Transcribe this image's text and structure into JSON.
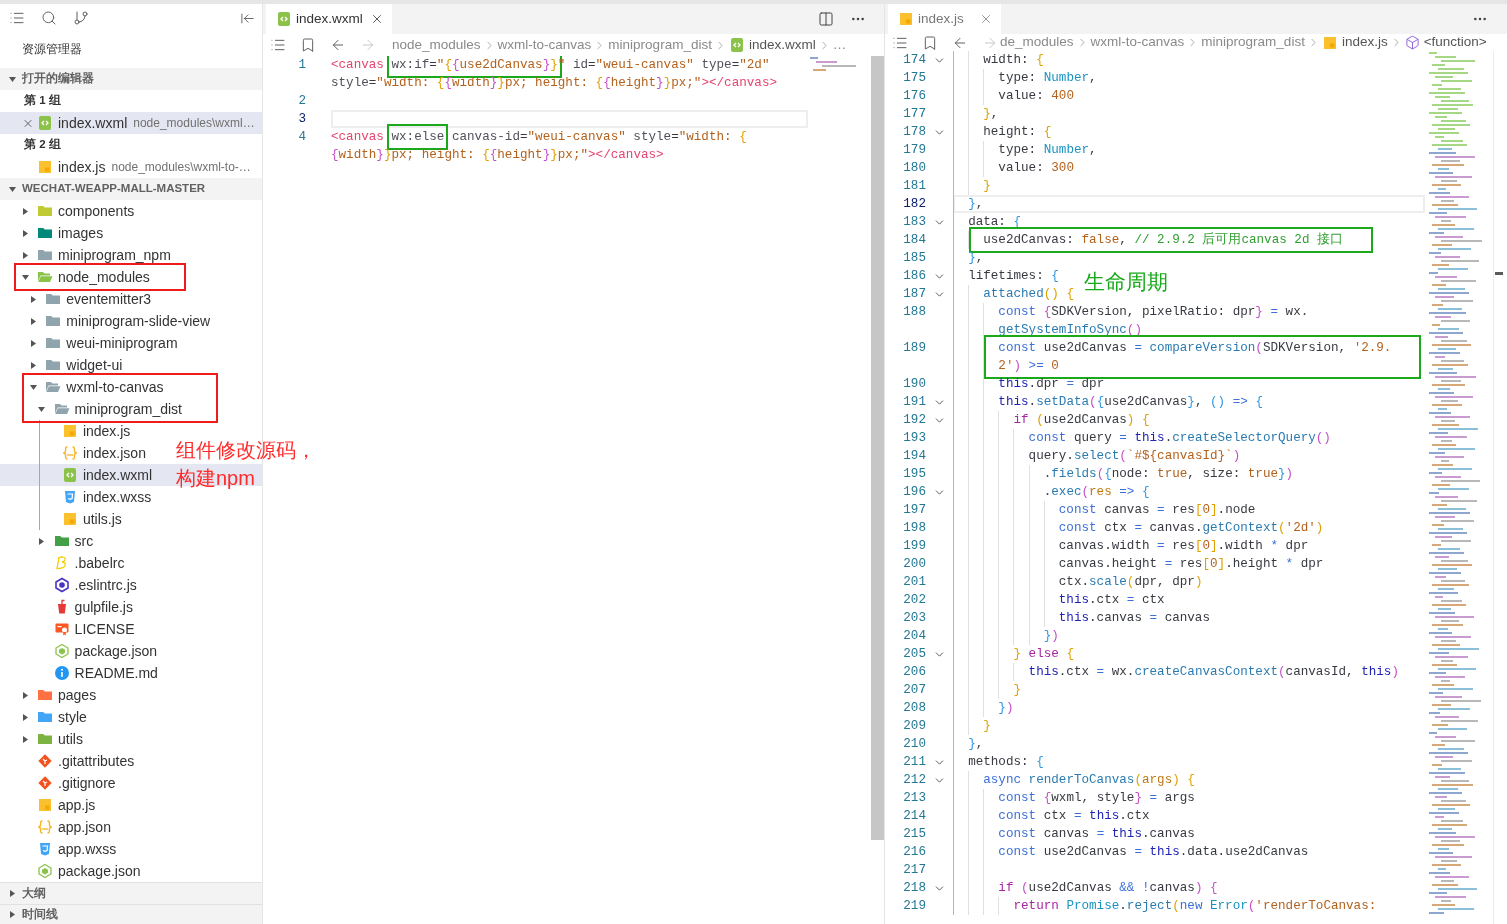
{
  "explorer": {
    "title": "资源管理器",
    "open_editors": {
      "label": "打开的编辑器",
      "expanded": true,
      "groups": [
        {
          "label": "第 1 组",
          "items": [
            {
              "name": "index.wxml",
              "description": "node_modules\\wxml…",
              "kind": "wxml",
              "selected": true
            }
          ]
        },
        {
          "label": "第 2 组",
          "items": [
            {
              "name": "index.js",
              "description": "node_modules\\wxml-to-…",
              "kind": "js",
              "selected": false
            }
          ]
        }
      ]
    },
    "project": {
      "label": "WECHAT-WEAPP-MALL-MASTER",
      "expanded": true,
      "tree": [
        {
          "name": "components",
          "kind": "folder",
          "color": "#c0ca33",
          "expanded": false,
          "selected": false,
          "framed": false
        },
        {
          "name": "images",
          "kind": "folder",
          "color": "#00897b",
          "expanded": false,
          "selected": false,
          "framed": false
        },
        {
          "name": "miniprogram_npm",
          "kind": "folder",
          "color": "#90a4ae",
          "expanded": false,
          "selected": false,
          "framed": false
        },
        {
          "name": "node_modules",
          "kind": "folder",
          "color": "#8bc34a",
          "expanded": true,
          "selected": false,
          "framed": true,
          "children": [
            {
              "name": "eventemitter3",
              "kind": "folder",
              "color": "#90a4ae",
              "expanded": false,
              "selected": false,
              "framed": false
            },
            {
              "name": "miniprogram-slide-view",
              "kind": "folder",
              "color": "#90a4ae",
              "expanded": false,
              "selected": false,
              "framed": false
            },
            {
              "name": "weui-miniprogram",
              "kind": "folder",
              "color": "#90a4ae",
              "expanded": false,
              "selected": false,
              "framed": false
            },
            {
              "name": "widget-ui",
              "kind": "folder",
              "color": "#90a4ae",
              "expanded": false,
              "selected": false,
              "framed": false
            },
            {
              "name": "wxml-to-canvas",
              "kind": "folder",
              "color": "#90a4ae",
              "expanded": true,
              "selected": false,
              "framed": true,
              "children": [
                {
                  "name": "miniprogram_dist",
                  "kind": "folder",
                  "color": "#90a4ae",
                  "expanded": true,
                  "selected": false,
                  "framed": true,
                  "children": [
                    {
                      "name": "index.js",
                      "kind": "js",
                      "selected": false,
                      "framed": false
                    },
                    {
                      "name": "index.json",
                      "kind": "json",
                      "selected": false,
                      "framed": false
                    },
                    {
                      "name": "index.wxml",
                      "kind": "wxml",
                      "selected": true,
                      "framed": false
                    },
                    {
                      "name": "index.wxss",
                      "kind": "wxss",
                      "selected": false,
                      "framed": false
                    },
                    {
                      "name": "utils.js",
                      "kind": "js",
                      "selected": false,
                      "framed": false
                    }
                  ]
                },
                {
                  "name": "src",
                  "kind": "folder",
                  "color": "#43a047",
                  "expanded": false,
                  "selected": false,
                  "framed": false
                },
                {
                  "name": ".babelrc",
                  "kind": "babel",
                  "selected": false,
                  "framed": false
                },
                {
                  "name": ".eslintrc.js",
                  "kind": "eslint",
                  "selected": false,
                  "framed": false
                },
                {
                  "name": "gulpfile.js",
                  "kind": "gulp",
                  "selected": false,
                  "framed": false
                },
                {
                  "name": "LICENSE",
                  "kind": "license",
                  "selected": false,
                  "framed": false
                },
                {
                  "name": "package.json",
                  "kind": "npm",
                  "selected": false,
                  "framed": false
                },
                {
                  "name": "README.md",
                  "kind": "info",
                  "selected": false,
                  "framed": false
                }
              ]
            }
          ]
        },
        {
          "name": "pages",
          "kind": "folder",
          "color": "#ff7043",
          "expanded": false,
          "selected": false,
          "framed": false
        },
        {
          "name": "style",
          "kind": "folder",
          "color": "#42a5f5",
          "expanded": false,
          "selected": false,
          "framed": false
        },
        {
          "name": "utils",
          "kind": "folder",
          "color": "#7cb342",
          "expanded": false,
          "selected": false,
          "framed": false
        },
        {
          "name": ".gitattributes",
          "kind": "git",
          "selected": false,
          "framed": false
        },
        {
          "name": ".gitignore",
          "kind": "git",
          "selected": false,
          "framed": false
        },
        {
          "name": "app.js",
          "kind": "js",
          "selected": false,
          "framed": false
        },
        {
          "name": "app.json",
          "kind": "json",
          "selected": false,
          "framed": false
        },
        {
          "name": "app.wxss",
          "kind": "wxss",
          "selected": false,
          "framed": false
        },
        {
          "name": "package.json",
          "kind": "npm",
          "selected": false,
          "framed": false
        }
      ]
    },
    "note": [
      "组件修改源码，",
      "构建npm"
    ],
    "sections": [
      {
        "label": "大纲",
        "expanded": false
      },
      {
        "label": "时间线",
        "expanded": false
      }
    ]
  },
  "editors": [
    {
      "focused": true,
      "tabs": [
        {
          "label": "index.wxml",
          "kind": "wxml",
          "selected": true
        }
      ],
      "nav": [
        {
          "kind": "back",
          "disabled": false
        },
        {
          "kind": "forward",
          "disabled": true
        }
      ],
      "breadcrumb": [
        {
          "label": "node_modules"
        },
        {
          "label": "wxml-to-canvas"
        },
        {
          "label": "miniprogram_dist"
        },
        {
          "label": "index.wxml",
          "kind": "wxml"
        },
        {
          "label": "…"
        }
      ],
      "lines": [
        {
          "n": "1",
          "current": false,
          "tokens": [
            {
              "kind": "tag",
              "text": "<canvas "
            },
            {
              "kind": "frame",
              "tokens": [
                {
                  "kind": "attr",
                  "text": "wx:if"
                },
                {
                  "kind": "p",
                  "text": "="
                },
                {
                  "kind": "str",
                  "text": "\""
                },
                {
                  "kind": "b1",
                  "text": "{"
                },
                {
                  "kind": "b2",
                  "text": "{"
                },
                {
                  "kind": "str",
                  "text": "use2dCanvas"
                },
                {
                  "kind": "b2",
                  "text": "}"
                },
                {
                  "kind": "b1",
                  "text": "}"
                }
              ]
            },
            {
              "kind": "str",
              "text": "\" "
            },
            {
              "kind": "attr",
              "text": "id"
            },
            {
              "kind": "p",
              "text": "="
            },
            {
              "kind": "str",
              "text": "\"weui-canvas\" "
            },
            {
              "kind": "attr",
              "text": "type"
            },
            {
              "kind": "p",
              "text": "="
            },
            {
              "kind": "str",
              "text": "\"2d\""
            }
          ],
          "continuation": [
            {
              "kind": "attr",
              "text": "style"
            },
            {
              "kind": "p",
              "text": "="
            },
            {
              "kind": "str",
              "text": "\"width: "
            },
            {
              "kind": "b1",
              "text": "{"
            },
            {
              "kind": "b2",
              "text": "{"
            },
            {
              "kind": "str",
              "text": "width"
            },
            {
              "kind": "b2",
              "text": "}"
            },
            {
              "kind": "b1",
              "text": "}"
            },
            {
              "kind": "str",
              "text": "px; height: "
            },
            {
              "kind": "b1",
              "text": "{"
            },
            {
              "kind": "b2",
              "text": "{"
            },
            {
              "kind": "str",
              "text": "height"
            },
            {
              "kind": "b2",
              "text": "}"
            },
            {
              "kind": "b1",
              "text": "}"
            },
            {
              "kind": "str",
              "text": "px;\""
            },
            {
              "kind": "tag",
              "text": "></canvas>"
            }
          ]
        },
        {
          "n": "2",
          "current": false
        },
        {
          "n": "3",
          "current": true
        },
        {
          "n": "4",
          "current": false,
          "tokens": [
            {
              "kind": "tag",
              "text": "<canvas "
            },
            {
              "kind": "frame",
              "tokens": [
                {
                  "kind": "attr",
                  "text": "wx:else"
                }
              ]
            },
            {
              "kind": "attr",
              "text": " canvas-id"
            },
            {
              "kind": "p",
              "text": "="
            },
            {
              "kind": "str",
              "text": "\"weui-canvas\" "
            },
            {
              "kind": "attr",
              "text": "style"
            },
            {
              "kind": "p",
              "text": "="
            },
            {
              "kind": "str",
              "text": "\"width: "
            },
            {
              "kind": "b1",
              "text": "{"
            }
          ],
          "continuation": [
            {
              "kind": "b2",
              "text": "{"
            },
            {
              "kind": "str",
              "text": "width"
            },
            {
              "kind": "b2",
              "text": "}"
            },
            {
              "kind": "b1",
              "text": "}"
            },
            {
              "kind": "str",
              "text": "px; height: "
            },
            {
              "kind": "b1",
              "text": "{"
            },
            {
              "kind": "b2",
              "text": "{"
            },
            {
              "kind": "str",
              "text": "height"
            },
            {
              "kind": "b2",
              "text": "}"
            },
            {
              "kind": "b1",
              "text": "}"
            },
            {
              "kind": "str",
              "text": "px;\""
            },
            {
              "kind": "tag",
              "text": "></canvas>"
            }
          ]
        }
      ]
    },
    {
      "focused": false,
      "tabs": [
        {
          "label": "index.js",
          "kind": "js",
          "selected": true
        }
      ],
      "nav": [
        {
          "kind": "back",
          "disabled": false
        },
        {
          "kind": "forward",
          "disabled": true
        }
      ],
      "breadcrumb": [
        {
          "label": "de_modules"
        },
        {
          "label": "wxml-to-canvas"
        },
        {
          "label": "miniprogram_dist"
        },
        {
          "label": "index.js",
          "kind": "js"
        },
        {
          "label": "<function>",
          "kind": "symbol"
        }
      ],
      "note": "生命周期",
      "lines": [
        {
          "n": "174",
          "fold": true,
          "current": false,
          "framed": false,
          "tokens": [
            {
              "kind": "p",
              "text": "    width: "
            },
            {
              "kind": "b1",
              "text": "{"
            }
          ]
        },
        {
          "n": "175",
          "fold": false,
          "current": false,
          "framed": false,
          "tokens": [
            {
              "kind": "p",
              "text": "      type: "
            },
            {
              "kind": "type",
              "text": "Number"
            },
            {
              "kind": "p",
              "text": ","
            }
          ]
        },
        {
          "n": "176",
          "fold": false,
          "current": false,
          "framed": false,
          "tokens": [
            {
              "kind": "p",
              "text": "      value: "
            },
            {
              "kind": "num",
              "text": "400"
            }
          ]
        },
        {
          "n": "177",
          "fold": false,
          "current": false,
          "framed": false,
          "tokens": [
            {
              "kind": "b1",
              "text": "    }"
            },
            {
              "kind": "p",
              "text": ","
            }
          ]
        },
        {
          "n": "178",
          "fold": true,
          "current": false,
          "framed": false,
          "tokens": [
            {
              "kind": "p",
              "text": "    height: "
            },
            {
              "kind": "b1",
              "text": "{"
            }
          ]
        },
        {
          "n": "179",
          "fold": false,
          "current": false,
          "framed": false,
          "tokens": [
            {
              "kind": "p",
              "text": "      type: "
            },
            {
              "kind": "type",
              "text": "Number"
            },
            {
              "kind": "p",
              "text": ","
            }
          ]
        },
        {
          "n": "180",
          "fold": false,
          "current": false,
          "framed": false,
          "tokens": [
            {
              "kind": "p",
              "text": "      value: "
            },
            {
              "kind": "num",
              "text": "300"
            }
          ]
        },
        {
          "n": "181",
          "fold": false,
          "current": false,
          "framed": false,
          "tokens": [
            {
              "kind": "b1",
              "text": "    }"
            }
          ]
        },
        {
          "n": "182",
          "fold": false,
          "current": true,
          "framed": false,
          "tokens": [
            {
              "kind": "b3",
              "text": "  }"
            },
            {
              "kind": "p",
              "text": ","
            }
          ]
        },
        {
          "n": "183",
          "fold": true,
          "current": false,
          "framed": false,
          "tokens": [
            {
              "kind": "p",
              "text": "  data: "
            },
            {
              "kind": "b3",
              "text": "{"
            }
          ]
        },
        {
          "n": "184",
          "fold": false,
          "current": false,
          "framed": true,
          "tokens": [
            {
              "kind": "p",
              "text": "    use2dCanvas: "
            },
            {
              "kind": "num",
              "text": "false"
            },
            {
              "kind": "p",
              "text": ", "
            },
            {
              "kind": "cmt",
              "text": "// 2.9.2 后可用canvas 2d 接口"
            }
          ]
        },
        {
          "n": "185",
          "fold": false,
          "current": false,
          "framed": false,
          "tokens": [
            {
              "kind": "b3",
              "text": "  }"
            },
            {
              "kind": "p",
              "text": ","
            }
          ]
        },
        {
          "n": "186",
          "fold": true,
          "current": false,
          "framed": false,
          "tokens": [
            {
              "kind": "p",
              "text": "  lifetimes: "
            },
            {
              "kind": "b3",
              "text": "{"
            }
          ]
        },
        {
          "n": "187",
          "fold": true,
          "current": false,
          "framed": false,
          "tokens": [
            {
              "kind": "fn",
              "text": "    attached"
            },
            {
              "kind": "b1",
              "text": "() {"
            }
          ]
        },
        {
          "n": "188",
          "fold": false,
          "current": false,
          "framed": false,
          "tokens": [
            {
              "kind": "kw",
              "text": "      const "
            },
            {
              "kind": "b2",
              "text": "{"
            },
            {
              "kind": "p",
              "text": "SDKVersion, pixelRatio: dpr"
            },
            {
              "kind": "b2",
              "text": "} "
            },
            {
              "kind": "op",
              "text": "= "
            },
            {
              "kind": "p",
              "text": "wx."
            }
          ],
          "continuation": [
            {
              "kind": "fn",
              "text": "getSystemInfoSync"
            },
            {
              "kind": "b2",
              "text": "()"
            }
          ]
        },
        {
          "n": "189",
          "fold": false,
          "current": false,
          "framed": true,
          "tokens": [
            {
              "kind": "kw",
              "text": "      const "
            },
            {
              "kind": "p",
              "text": "use2dCanvas "
            },
            {
              "kind": "op",
              "text": "= "
            },
            {
              "kind": "fn",
              "text": "compareVersion"
            },
            {
              "kind": "b2",
              "text": "("
            },
            {
              "kind": "p",
              "text": "SDKVersion, "
            },
            {
              "kind": "str",
              "text": "'2.9."
            }
          ],
          "continuation": [
            {
              "kind": "str",
              "text": "2'"
            },
            {
              "kind": "b2",
              "text": ") "
            },
            {
              "kind": "op",
              "text": ">= "
            },
            {
              "kind": "num",
              "text": "0"
            }
          ]
        },
        {
          "n": "190",
          "fold": false,
          "current": false,
          "framed": false,
          "tokens": [
            {
              "kind": "this",
              "text": "      this"
            },
            {
              "kind": "p",
              "text": ".dpr "
            },
            {
              "kind": "op",
              "text": "= "
            },
            {
              "kind": "p",
              "text": "dpr"
            }
          ]
        },
        {
          "n": "191",
          "fold": true,
          "current": false,
          "framed": false,
          "tokens": [
            {
              "kind": "this",
              "text": "      this"
            },
            {
              "kind": "p",
              "text": "."
            },
            {
              "kind": "fn",
              "text": "setData"
            },
            {
              "kind": "b2",
              "text": "("
            },
            {
              "kind": "b3",
              "text": "{"
            },
            {
              "kind": "p",
              "text": "use2dCanvas"
            },
            {
              "kind": "b3",
              "text": "}"
            },
            {
              "kind": "p",
              "text": ", "
            },
            {
              "kind": "b3",
              "text": "() "
            },
            {
              "kind": "op",
              "text": "=> "
            },
            {
              "kind": "b3",
              "text": "{"
            }
          ]
        },
        {
          "n": "192",
          "fold": true,
          "current": false,
          "framed": false,
          "tokens": [
            {
              "kind": "ctrl",
              "text": "        if "
            },
            {
              "kind": "b1",
              "text": "("
            },
            {
              "kind": "p",
              "text": "use2dCanvas"
            },
            {
              "kind": "b1",
              "text": ") {"
            }
          ]
        },
        {
          "n": "193",
          "fold": false,
          "current": false,
          "framed": false,
          "tokens": [
            {
              "kind": "kw",
              "text": "          const "
            },
            {
              "kind": "p",
              "text": "query "
            },
            {
              "kind": "op",
              "text": "= "
            },
            {
              "kind": "this",
              "text": "this"
            },
            {
              "kind": "p",
              "text": "."
            },
            {
              "kind": "fn",
              "text": "createSelectorQuery"
            },
            {
              "kind": "b2",
              "text": "()"
            }
          ]
        },
        {
          "n": "194",
          "fold": false,
          "current": false,
          "framed": false,
          "tokens": [
            {
              "kind": "p",
              "text": "          query."
            },
            {
              "kind": "fn",
              "text": "select"
            },
            {
              "kind": "b2",
              "text": "("
            },
            {
              "kind": "str",
              "text": "`#${canvasId}`"
            },
            {
              "kind": "b2",
              "text": ")"
            }
          ]
        },
        {
          "n": "195",
          "fold": false,
          "current": false,
          "framed": false,
          "tokens": [
            {
              "kind": "p",
              "text": "            ."
            },
            {
              "kind": "fn",
              "text": "fields"
            },
            {
              "kind": "b2",
              "text": "("
            },
            {
              "kind": "b3",
              "text": "{"
            },
            {
              "kind": "p",
              "text": "node: "
            },
            {
              "kind": "num",
              "text": "true"
            },
            {
              "kind": "p",
              "text": ", size: "
            },
            {
              "kind": "num",
              "text": "true"
            },
            {
              "kind": "b3",
              "text": "}"
            },
            {
              "kind": "b2",
              "text": ")"
            }
          ]
        },
        {
          "n": "196",
          "fold": true,
          "current": false,
          "framed": false,
          "tokens": [
            {
              "kind": "p",
              "text": "            ."
            },
            {
              "kind": "fn",
              "text": "exec"
            },
            {
              "kind": "b2",
              "text": "("
            },
            {
              "kind": "param",
              "text": "res "
            },
            {
              "kind": "op",
              "text": "=> "
            },
            {
              "kind": "b3",
              "text": "{"
            }
          ]
        },
        {
          "n": "197",
          "fold": false,
          "current": false,
          "framed": false,
          "tokens": [
            {
              "kind": "kw",
              "text": "              const "
            },
            {
              "kind": "p",
              "text": "canvas "
            },
            {
              "kind": "op",
              "text": "= "
            },
            {
              "kind": "p",
              "text": "res"
            },
            {
              "kind": "b1",
              "text": "["
            },
            {
              "kind": "num",
              "text": "0"
            },
            {
              "kind": "b1",
              "text": "]"
            },
            {
              "kind": "p",
              "text": ".node"
            }
          ]
        },
        {
          "n": "198",
          "fold": false,
          "current": false,
          "framed": false,
          "tokens": [
            {
              "kind": "kw",
              "text": "              const "
            },
            {
              "kind": "p",
              "text": "ctx "
            },
            {
              "kind": "op",
              "text": "= "
            },
            {
              "kind": "p",
              "text": "canvas."
            },
            {
              "kind": "fn",
              "text": "getContext"
            },
            {
              "kind": "b1",
              "text": "("
            },
            {
              "kind": "str",
              "text": "'2d'"
            },
            {
              "kind": "b1",
              "text": ")"
            }
          ]
        },
        {
          "n": "199",
          "fold": false,
          "current": false,
          "framed": false,
          "tokens": [
            {
              "kind": "p",
              "text": "              canvas.width "
            },
            {
              "kind": "op",
              "text": "= "
            },
            {
              "kind": "p",
              "text": "res"
            },
            {
              "kind": "b1",
              "text": "["
            },
            {
              "kind": "num",
              "text": "0"
            },
            {
              "kind": "b1",
              "text": "]"
            },
            {
              "kind": "p",
              "text": ".width "
            },
            {
              "kind": "op",
              "text": "* "
            },
            {
              "kind": "p",
              "text": "dpr"
            }
          ]
        },
        {
          "n": "200",
          "fold": false,
          "current": false,
          "framed": false,
          "tokens": [
            {
              "kind": "p",
              "text": "              canvas.height "
            },
            {
              "kind": "op",
              "text": "= "
            },
            {
              "kind": "p",
              "text": "res"
            },
            {
              "kind": "b1",
              "text": "["
            },
            {
              "kind": "num",
              "text": "0"
            },
            {
              "kind": "b1",
              "text": "]"
            },
            {
              "kind": "p",
              "text": ".height "
            },
            {
              "kind": "op",
              "text": "* "
            },
            {
              "kind": "p",
              "text": "dpr"
            }
          ]
        },
        {
          "n": "201",
          "fold": false,
          "current": false,
          "framed": false,
          "tokens": [
            {
              "kind": "p",
              "text": "              ctx."
            },
            {
              "kind": "fn",
              "text": "scale"
            },
            {
              "kind": "b1",
              "text": "("
            },
            {
              "kind": "p",
              "text": "dpr, dpr"
            },
            {
              "kind": "b1",
              "text": ")"
            }
          ]
        },
        {
          "n": "202",
          "fold": false,
          "current": false,
          "framed": false,
          "tokens": [
            {
              "kind": "this",
              "text": "              this"
            },
            {
              "kind": "p",
              "text": ".ctx "
            },
            {
              "kind": "op",
              "text": "= "
            },
            {
              "kind": "p",
              "text": "ctx"
            }
          ]
        },
        {
          "n": "203",
          "fold": false,
          "current": false,
          "framed": false,
          "tokens": [
            {
              "kind": "this",
              "text": "              this"
            },
            {
              "kind": "p",
              "text": ".canvas "
            },
            {
              "kind": "op",
              "text": "= "
            },
            {
              "kind": "p",
              "text": "canvas"
            }
          ]
        },
        {
          "n": "204",
          "fold": false,
          "current": false,
          "framed": false,
          "tokens": [
            {
              "kind": "b3",
              "text": "            }"
            },
            {
              "kind": "b2",
              "text": ")"
            }
          ]
        },
        {
          "n": "205",
          "fold": true,
          "current": false,
          "framed": false,
          "tokens": [
            {
              "kind": "b1",
              "text": "        } "
            },
            {
              "kind": "ctrl",
              "text": "else "
            },
            {
              "kind": "b1",
              "text": "{"
            }
          ]
        },
        {
          "n": "206",
          "fold": false,
          "current": false,
          "framed": false,
          "tokens": [
            {
              "kind": "this",
              "text": "          this"
            },
            {
              "kind": "p",
              "text": ".ctx "
            },
            {
              "kind": "op",
              "text": "= "
            },
            {
              "kind": "p",
              "text": "wx."
            },
            {
              "kind": "fn",
              "text": "createCanvasContext"
            },
            {
              "kind": "b2",
              "text": "("
            },
            {
              "kind": "p",
              "text": "canvasId, "
            },
            {
              "kind": "this",
              "text": "this"
            },
            {
              "kind": "b2",
              "text": ")"
            }
          ]
        },
        {
          "n": "207",
          "fold": false,
          "current": false,
          "framed": false,
          "tokens": [
            {
              "kind": "b1",
              "text": "        }"
            }
          ]
        },
        {
          "n": "208",
          "fold": false,
          "current": false,
          "framed": false,
          "tokens": [
            {
              "kind": "b3",
              "text": "      }"
            },
            {
              "kind": "b2",
              "text": ")"
            }
          ]
        },
        {
          "n": "209",
          "fold": false,
          "current": false,
          "framed": false,
          "tokens": [
            {
              "kind": "b1",
              "text": "    }"
            }
          ]
        },
        {
          "n": "210",
          "fold": false,
          "current": false,
          "framed": false,
          "tokens": [
            {
              "kind": "b3",
              "text": "  }"
            },
            {
              "kind": "p",
              "text": ","
            }
          ]
        },
        {
          "n": "211",
          "fold": true,
          "current": false,
          "framed": false,
          "tokens": [
            {
              "kind": "p",
              "text": "  methods: "
            },
            {
              "kind": "b3",
              "text": "{"
            }
          ]
        },
        {
          "n": "212",
          "fold": true,
          "current": false,
          "framed": false,
          "tokens": [
            {
              "kind": "kw",
              "text": "    async "
            },
            {
              "kind": "fn",
              "text": "renderToCanvas"
            },
            {
              "kind": "b1",
              "text": "("
            },
            {
              "kind": "param",
              "text": "args"
            },
            {
              "kind": "b1",
              "text": ") {"
            }
          ]
        },
        {
          "n": "213",
          "fold": false,
          "current": false,
          "framed": false,
          "tokens": [
            {
              "kind": "kw",
              "text": "      const "
            },
            {
              "kind": "b2",
              "text": "{"
            },
            {
              "kind": "p",
              "text": "wxml, style"
            },
            {
              "kind": "b2",
              "text": "} "
            },
            {
              "kind": "op",
              "text": "= "
            },
            {
              "kind": "p",
              "text": "args"
            }
          ]
        },
        {
          "n": "214",
          "fold": false,
          "current": false,
          "framed": false,
          "tokens": [
            {
              "kind": "kw",
              "text": "      const "
            },
            {
              "kind": "p",
              "text": "ctx "
            },
            {
              "kind": "op",
              "text": "= "
            },
            {
              "kind": "this",
              "text": "this"
            },
            {
              "kind": "p",
              "text": ".ctx"
            }
          ]
        },
        {
          "n": "215",
          "fold": false,
          "current": false,
          "framed": false,
          "tokens": [
            {
              "kind": "kw",
              "text": "      const "
            },
            {
              "kind": "p",
              "text": "canvas "
            },
            {
              "kind": "op",
              "text": "= "
            },
            {
              "kind": "this",
              "text": "this"
            },
            {
              "kind": "p",
              "text": ".canvas"
            }
          ]
        },
        {
          "n": "216",
          "fold": false,
          "current": false,
          "framed": false,
          "tokens": [
            {
              "kind": "kw",
              "text": "      const "
            },
            {
              "kind": "p",
              "text": "use2dCanvas "
            },
            {
              "kind": "op",
              "text": "= "
            },
            {
              "kind": "this",
              "text": "this"
            },
            {
              "kind": "p",
              "text": ".data.use2dCanvas"
            }
          ]
        },
        {
          "n": "217",
          "fold": false,
          "current": false,
          "framed": false
        },
        {
          "n": "218",
          "fold": true,
          "current": false,
          "framed": false,
          "tokens": [
            {
              "kind": "ctrl",
              "text": "      if "
            },
            {
              "kind": "b2",
              "text": "("
            },
            {
              "kind": "p",
              "text": "use2dCanvas "
            },
            {
              "kind": "op",
              "text": "&& !"
            },
            {
              "kind": "p",
              "text": "canvas"
            },
            {
              "kind": "b2",
              "text": ") {"
            }
          ]
        },
        {
          "n": "219",
          "fold": false,
          "current": false,
          "framed": false,
          "tokens": [
            {
              "kind": "ctrl",
              "text": "        return "
            },
            {
              "kind": "type",
              "text": "Promise"
            },
            {
              "kind": "p",
              "text": "."
            },
            {
              "kind": "fn",
              "text": "reject"
            },
            {
              "kind": "b1",
              "text": "("
            },
            {
              "kind": "kw",
              "text": "new "
            },
            {
              "kind": "type",
              "text": "Error"
            },
            {
              "kind": "b2",
              "text": "("
            },
            {
              "kind": "str",
              "text": "'renderToCanvas:"
            }
          ]
        }
      ]
    }
  ]
}
